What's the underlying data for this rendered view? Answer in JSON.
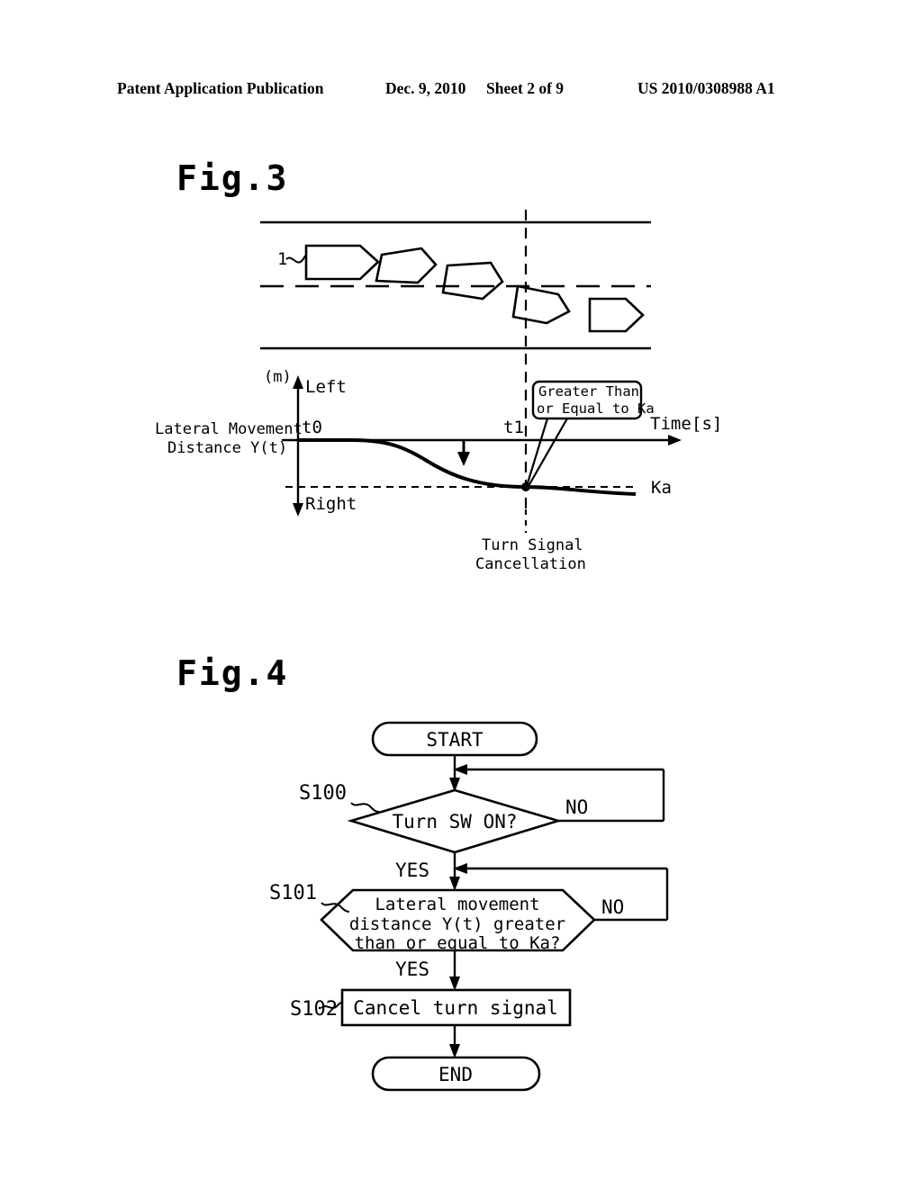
{
  "header": {
    "publication": "Patent Application Publication",
    "date": "Dec. 9, 2010",
    "sheet": "Sheet 2 of 9",
    "number": "US 2010/0308988 A1"
  },
  "figures": [
    {
      "caption": "Fig.3",
      "scene": {
        "vehicle_label": "1",
        "vehicle_count": 5,
        "lane_lines": [
          "solid-top",
          "dashed-center",
          "solid-bottom"
        ],
        "event_marker": "vertical-dashed-line"
      },
      "graph": {
        "y_unit": "(m)",
        "y_axis_up_label": "Left",
        "y_axis_down_label": "Right",
        "y_axis_title_line1": "Lateral Movement",
        "y_axis_title_line2": "Distance Y(t)",
        "x_axis_label": "Time",
        "x_axis_unit": "[s]",
        "tick_t0": "t0",
        "tick_t1": "t1",
        "threshold_label": "Ka",
        "callout_line1": "Greater Than",
        "callout_line2": "or Equal to Ka",
        "event_label_line1": "Turn Signal",
        "event_label_line2": "Cancellation"
      }
    },
    {
      "caption": "Fig.4",
      "flowchart": {
        "nodes": [
          {
            "id": "start",
            "type": "terminator",
            "label": "START",
            "step": ""
          },
          {
            "id": "s100",
            "type": "decision",
            "label": "Turn SW ON?",
            "step": "S100"
          },
          {
            "id": "s101",
            "type": "hexagon",
            "label_line1": "Lateral movement",
            "label_line2": "distance Y(t) greater",
            "label_line3": "than or equal to Ka?",
            "step": "S101"
          },
          {
            "id": "s102",
            "type": "process",
            "label": "Cancel turn signal",
            "step": "S102"
          },
          {
            "id": "end",
            "type": "terminator",
            "label": "END",
            "step": ""
          }
        ],
        "branch_labels": {
          "s100_yes": "YES",
          "s100_no": "NO",
          "s101_yes": "YES",
          "s101_no": "NO"
        }
      }
    }
  ],
  "colors": {
    "ink": "#000000",
    "paper": "#ffffff"
  }
}
